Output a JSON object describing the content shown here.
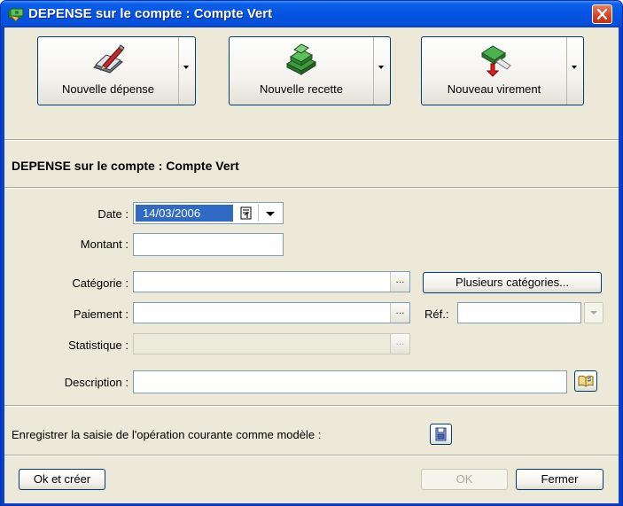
{
  "window": {
    "title": "DEPENSE sur le compte : Compte Vert"
  },
  "toolbar": {
    "new_expense_label": "Nouvelle dépense",
    "new_income_label": "Nouvelle recette",
    "new_transfer_label": "Nouveau virement"
  },
  "section": {
    "title": "DEPENSE sur le compte : Compte Vert"
  },
  "form": {
    "date_label": "Date :",
    "date_value": "14/03/2006",
    "amount_label": "Montant :",
    "amount_value": "",
    "category_label": "Catégorie :",
    "category_value": "",
    "multi_categories_label": "Plusieurs catégories...",
    "payment_label": "Paiement :",
    "payment_value": "",
    "ref_label": "Réf.:",
    "ref_value": "",
    "stat_label": "Statistique :",
    "stat_value": "",
    "description_label": "Description :",
    "description_value": "",
    "ellipsis": "..."
  },
  "template": {
    "label": "Enregistrer la saisie de l'opération courante comme modèle :"
  },
  "footer": {
    "ok_create_label": "Ok et créer",
    "ok_label": "OK",
    "close_label": "Fermer"
  },
  "colors": {
    "title_bar": "#0553e1",
    "dialog_bg": "#ece9d8",
    "selection": "#316ac5",
    "close_button": "#d3431f"
  }
}
